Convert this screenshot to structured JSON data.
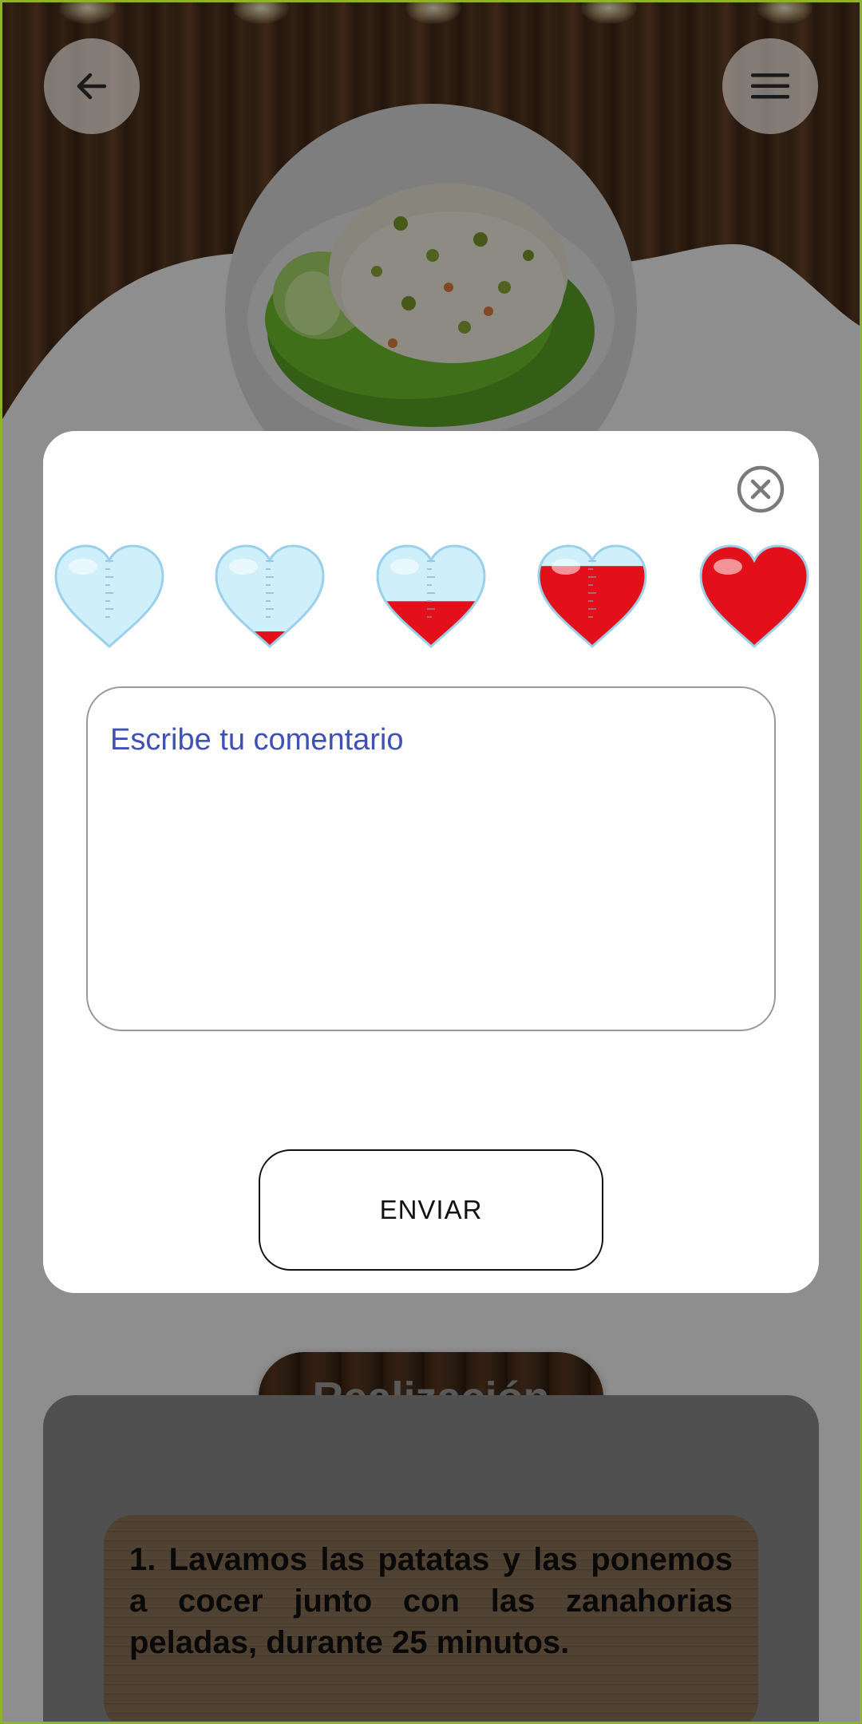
{
  "header": {
    "back_icon": "arrow-left-icon",
    "menu_icon": "hamburger-menu-icon",
    "dish_image": "russian-salad-photo"
  },
  "dialog": {
    "close_icon": "close-circle-icon",
    "rating": {
      "options": [
        {
          "label": "1",
          "fill": 0.0
        },
        {
          "label": "2",
          "fill": 0.15
        },
        {
          "label": "3",
          "fill": 0.45
        },
        {
          "label": "4",
          "fill": 0.8
        },
        {
          "label": "5",
          "fill": 1.0
        }
      ],
      "empty_color": "#cfeffa",
      "fill_color": "#e3101c"
    },
    "comment_placeholder": "Escribe tu comentario",
    "comment_value": "",
    "send_label": "ENVIAR"
  },
  "background": {
    "section_title": "Realización",
    "steps": [
      "1.  Lavamos las patatas y las ponemos a cocer junto con las zanahorias peladas, durante 25 minutos."
    ]
  },
  "colors": {
    "accent": "#3f51b5",
    "frame": "#8eb32a",
    "dialog_bg": "#ffffff"
  }
}
